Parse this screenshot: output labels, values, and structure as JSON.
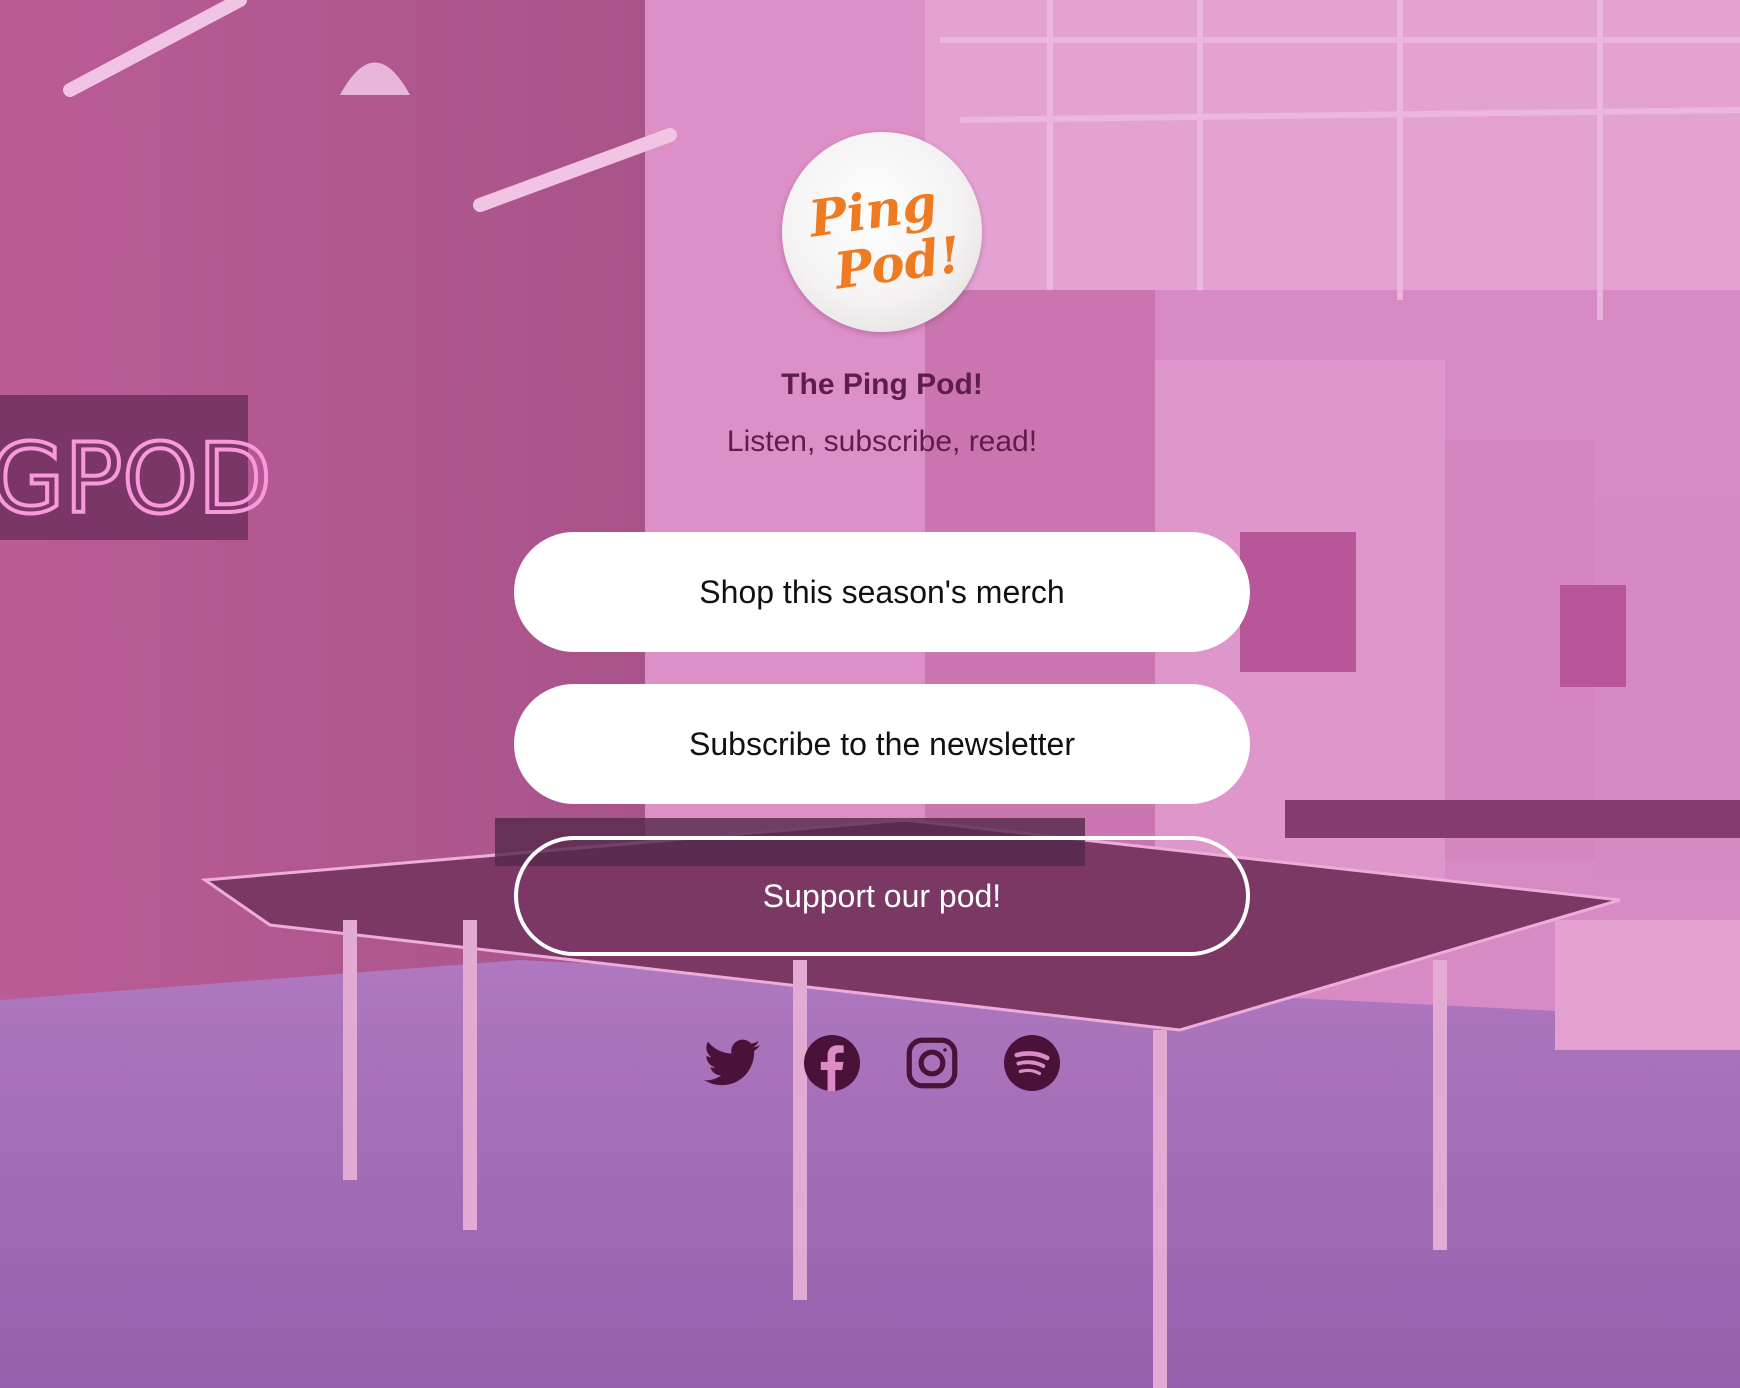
{
  "profile": {
    "logo_alt": "Ping Pod!",
    "name": "The Ping Pod!",
    "bio": "Listen, subscribe, read!"
  },
  "links": [
    {
      "label": "Shop this season's merch"
    },
    {
      "label": "Subscribe to the newsletter"
    },
    {
      "label": "Support our pod!"
    }
  ],
  "socials": [
    {
      "icon": "twitter-icon"
    },
    {
      "icon": "facebook-icon"
    },
    {
      "icon": "instagram-icon"
    },
    {
      "icon": "spotify-icon"
    }
  ],
  "colors": {
    "overlay": "#d681c0",
    "text_dark": "#5e1d4c",
    "icon": "#4a1238",
    "logo_orange": "#ee7a22"
  }
}
